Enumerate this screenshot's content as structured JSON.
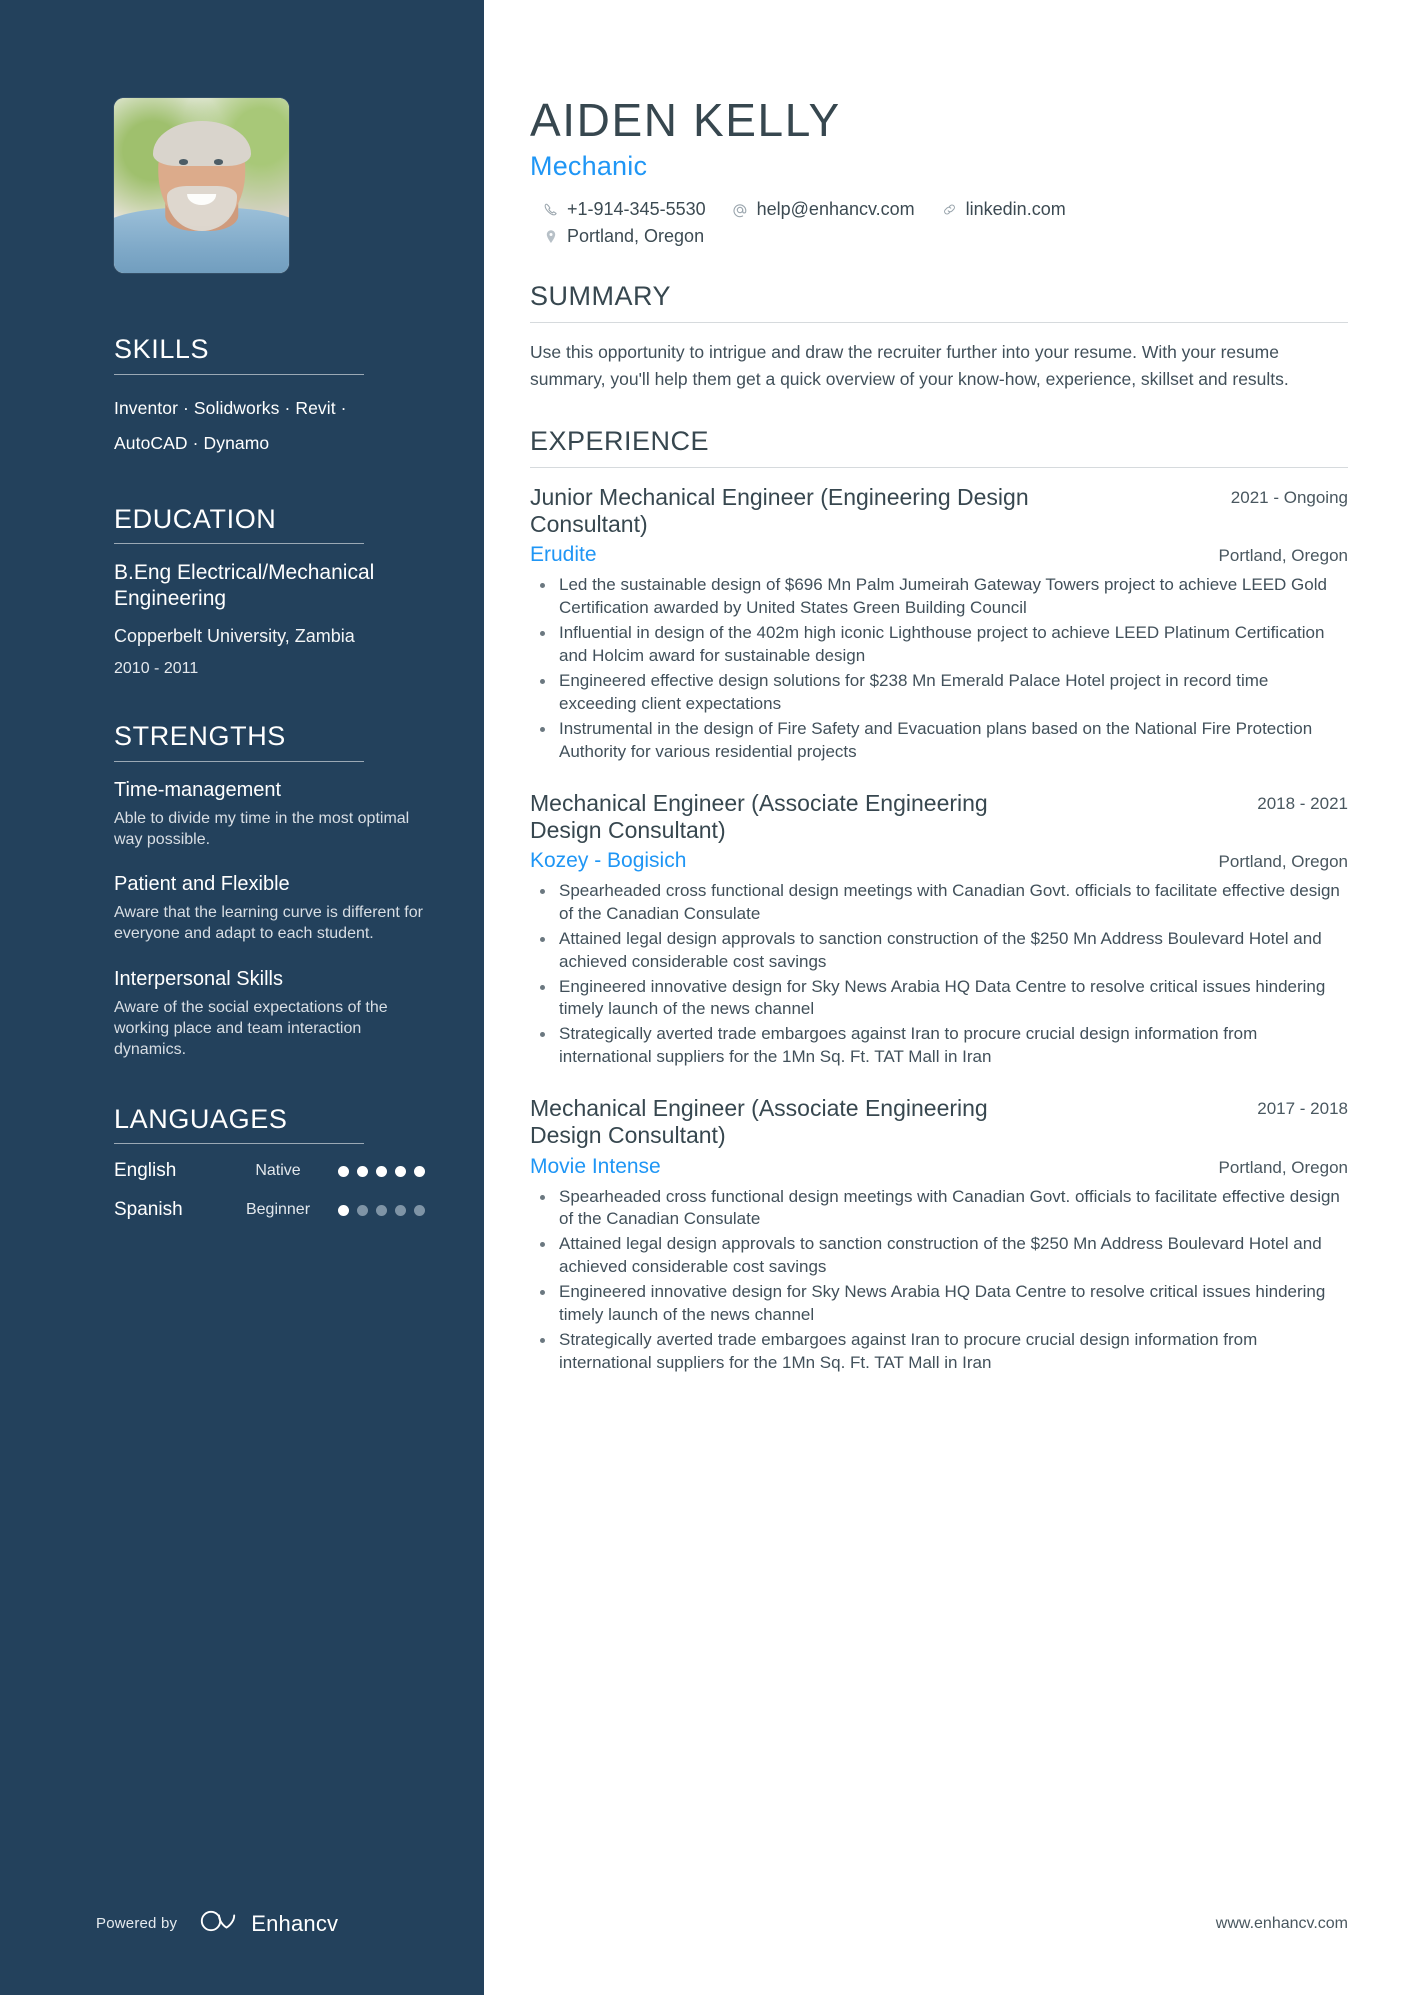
{
  "theme": {
    "sidebar_bg": "#23415c",
    "accent": "#1f96f5",
    "heading": "#37474f",
    "body_text": "#41505a"
  },
  "header": {
    "name": "AIDEN KELLY",
    "role": "Mechanic",
    "contacts": {
      "phone": "+1-914-345-5530",
      "email": "help@enhancv.com",
      "linkedin": "linkedin.com",
      "location": "Portland, Oregon"
    },
    "icons": {
      "phone": "phone-icon",
      "email": "at-sign-icon",
      "link": "link-icon",
      "location": "map-pin-icon"
    }
  },
  "sidebar": {
    "photo_alt": "profile-photo",
    "skills": {
      "title": "SKILLS",
      "lines": [
        "Inventor · Solidworks · Revit ·",
        "AutoCAD · Dynamo"
      ]
    },
    "education": {
      "title": "EDUCATION",
      "degree": "B.Eng Electrical/Mechanical Engineering",
      "school": "Copperbelt University, Zambia",
      "dates": "2010 - 2011"
    },
    "strengths": {
      "title": "STRENGTHS",
      "items": [
        {
          "title": "Time-management",
          "desc": "Able to divide my time in the most optimal way possible."
        },
        {
          "title": "Patient and Flexible",
          "desc": "Aware that the learning curve is different for everyone and adapt to each student."
        },
        {
          "title": "Interpersonal Skills",
          "desc": "Aware of the social expectations of the working place and team interaction dynamics."
        }
      ]
    },
    "languages": {
      "title": "LANGUAGES",
      "items": [
        {
          "name": "English",
          "level": "Native",
          "filled": 5,
          "total": 5
        },
        {
          "name": "Spanish",
          "level": "Beginner",
          "filled": 1,
          "total": 5
        }
      ]
    },
    "footer": {
      "powered_by": "Powered by",
      "brand": "Enhancv"
    }
  },
  "main": {
    "summary": {
      "title": "SUMMARY",
      "text": "Use this opportunity to intrigue and draw the recruiter further into your resume. With your resume summary, you'll help them get a quick overview of your know-how, experience, skillset and results."
    },
    "experience": {
      "title": "EXPERIENCE",
      "jobs": [
        {
          "title": "Junior Mechanical Engineer (Engineering Design Consultant)",
          "company": "Erudite",
          "dates": "2021 - Ongoing",
          "location": "Portland, Oregon",
          "bullets": [
            "Led the sustainable design of $696 Mn Palm Jumeirah Gateway Towers project to achieve LEED Gold Certification awarded by United States Green Building Council",
            "Influential in design of the 402m high iconic Lighthouse project to achieve LEED Platinum Certification and Holcim award for sustainable design",
            "Engineered effective design solutions for $238 Mn Emerald Palace Hotel project in record time exceeding client expectations",
            "Instrumental in the design of Fire Safety and Evacuation plans based on the National Fire Protection Authority for various residential projects"
          ]
        },
        {
          "title": "Mechanical Engineer (Associate Engineering Design Consultant)",
          "company": "Kozey - Bogisich",
          "dates": "2018 - 2021",
          "location": "Portland, Oregon",
          "bullets": [
            "Spearheaded cross functional design meetings with Canadian Govt. officials to facilitate effective design of the Canadian Consulate",
            "Attained legal design approvals to sanction construction of the $250 Mn Address Boulevard Hotel and achieved considerable cost savings",
            "Engineered innovative design for Sky News Arabia HQ Data Centre to resolve critical issues hindering timely launch of the news channel",
            "Strategically averted trade embargoes against Iran to procure crucial design information from international suppliers for the 1Mn Sq. Ft. TAT Mall in Iran"
          ]
        },
        {
          "title": "Mechanical Engineer (Associate Engineering Design Consultant)",
          "company": "Movie Intense",
          "dates": "2017 - 2018",
          "location": "Portland, Oregon",
          "bullets": [
            "Spearheaded cross functional design meetings with Canadian Govt. officials to facilitate effective design of the Canadian Consulate",
            "Attained legal design approvals to sanction construction of the $250 Mn Address Boulevard Hotel and achieved considerable cost savings",
            "Engineered innovative design for Sky News Arabia HQ Data Centre to resolve critical issues hindering timely launch of the news channel",
            "Strategically averted trade embargoes against Iran to procure crucial design information from international suppliers for the 1Mn Sq. Ft. TAT Mall in Iran"
          ]
        }
      ]
    },
    "footer": {
      "website": "www.enhancv.com"
    }
  }
}
